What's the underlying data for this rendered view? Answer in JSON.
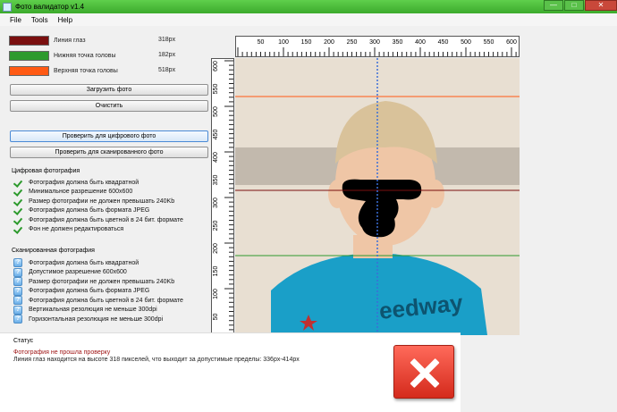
{
  "window": {
    "title": "Фото валидатор v1.4",
    "controls": {
      "minimize": "—",
      "maximize": "□",
      "close": "✕"
    }
  },
  "menu": [
    "File",
    "Tools",
    "Help"
  ],
  "legend": [
    {
      "label": "Линия глаз",
      "value": "318px",
      "color": "#7a0f0f"
    },
    {
      "label": "Нижняя точка головы",
      "value": "182px",
      "color": "#2e9a2e"
    },
    {
      "label": "Верхняя точка головы",
      "value": "518px",
      "color": "#ff5a14"
    }
  ],
  "buttons": {
    "load": "Загрузить фото",
    "clear": "Очистить",
    "check_digital": "Проверить для цифрового фото",
    "check_scanned": "Проверить для сканированного фото"
  },
  "digital": {
    "title": "Цифровая фотография",
    "items": [
      "Фотография должна быть квадратной",
      "Минимальное разрешение 600x600",
      "Размер фотографии не должен превышать 240Kb",
      "Фотография должна быть формата JPEG",
      "Фотография должна быть цветной в 24 бит. формате",
      "Фон не должен редактироваться"
    ]
  },
  "scanned": {
    "title": "Сканированная фотография",
    "items": [
      "Фотография должна быть квадратной",
      "Допустимое разрешение 600x600",
      "Размер фотографии не должен превышать 240Kb",
      "Фотография должна быть формата JPEG",
      "Фотография должна быть цветной в 24 бит. формате",
      "Вертикальная резолюция не меньше 300dpi",
      "Горизонтальная резолюция не меньше 300dpi"
    ]
  },
  "status": {
    "title": "Статус",
    "error": "Фотография не прошла проверку",
    "detail": "Линия глаз находится на высоте 318 пикселей, что выходит за допустимые пределы: 336px-414px"
  },
  "rulers": {
    "top_labels": [
      "50",
      "100",
      "150",
      "200",
      "250",
      "300",
      "350",
      "400",
      "450",
      "500",
      "550",
      "600"
    ],
    "left_labels": [
      "600",
      "550",
      "500",
      "450",
      "400",
      "350",
      "300",
      "250",
      "200",
      "150",
      "100",
      "50"
    ]
  },
  "photo": {
    "shirt_text": "eedway",
    "colors": {
      "background": "#e8dfd2",
      "band": "#b5aca0",
      "shirt": "#1a9fc8",
      "skin": "#efc6a6",
      "hair": "#d9c29a",
      "center_line": "#3a6fd8"
    }
  }
}
